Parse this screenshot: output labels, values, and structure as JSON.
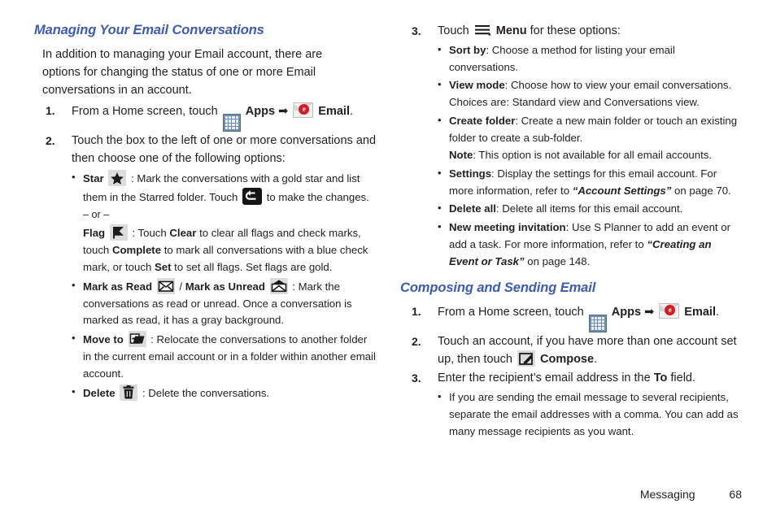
{
  "page": {
    "footer_section": "Messaging",
    "footer_page_number": "68",
    "heading_color": "#3b5bb5"
  },
  "left_column": {
    "heading": "Managing Your Email Conversations",
    "intro": "In addition to managing your Email account, there are options for changing the status of one or more Email conversations in an account.",
    "step1": {
      "number": "1.",
      "text_before_apps": "From a Home screen, touch",
      "apps_label": "Apps",
      "arrow": "➡",
      "email_label": "Email",
      "period": "."
    },
    "step2": {
      "number": "2.",
      "text": "Touch the box to the left of one or more conversations and then choose one of the following options:",
      "bullets": {
        "star": {
          "label": "Star",
          "text_a": ": Mark the conversations with a gold star and list them in the Starred folder. Touch",
          "text_b": "to make the changes.",
          "or_divider": "– or –"
        },
        "flag": {
          "label": "Flag",
          "seg1": ": Touch",
          "bold1": "Clear",
          "seg2": "to clear all flags and check marks, touch",
          "bold2": "Complete",
          "seg3": "to mark all conversations with a blue check mark, or touch",
          "bold3": "Set",
          "seg4": "to set all flags. Set flags are gold."
        },
        "mark_read": {
          "label_read": "Mark as Read",
          "separator": "/",
          "label_unread": "Mark as Unread",
          "text": ": Mark the conversations as read or unread. Once a conversation is marked as read, it has a gray background."
        },
        "move_to": {
          "label": "Move to",
          "text": ": Relocate the conversations to another folder in the current email account or in a folder within another email account."
        },
        "delete": {
          "label": "Delete",
          "text": ": Delete the conversations."
        }
      }
    }
  },
  "right_column": {
    "step3": {
      "number": "3.",
      "text_before_menu": "Touch",
      "menu_label": "Menu",
      "text_after_menu": "for these options:",
      "bullets": {
        "sort_by": {
          "label": "Sort by",
          "text": ": Choose a method for listing your email conversations."
        },
        "view_mode": {
          "label": "View mode",
          "text": ": Choose how to view your email conversations. Choices are: Standard view and Conversations view."
        },
        "create_folder": {
          "label": "Create folder",
          "text": ": Create a new main folder or touch an existing folder to create a sub-folder.",
          "note_label": "Note",
          "note_text": ": This option is not available for all email accounts."
        },
        "settings": {
          "label": "Settings",
          "text_a": ": Display the settings for this email account. For more information, refer to",
          "reference": "“Account Settings”",
          "text_b": "on page 70."
        },
        "delete_all": {
          "label": "Delete all",
          "text": ": Delete all items for this email account."
        },
        "new_meeting": {
          "label": "New meeting invitation",
          "text_a": ": Use S Planner to add an event or add a task. For more information, refer to",
          "reference": "“Creating an Event or Task”",
          "text_b": "on page 148."
        }
      }
    },
    "heading2": "Composing and Sending Email",
    "step1": {
      "number": "1.",
      "text_before_apps": "From a Home screen, touch",
      "apps_label": "Apps",
      "arrow": "➡",
      "email_label": "Email",
      "period": "."
    },
    "step2": {
      "number": "2.",
      "text_a": "Touch an account, if you have more than one account set up, then touch",
      "compose_label": "Compose",
      "period": "."
    },
    "step3b": {
      "number": "3.",
      "text_a": "Enter the recipient’s email address in the",
      "to_label": "To",
      "text_b": "field.",
      "bullet": "If you are sending the email message to several recipients, separate the email addresses with a comma. You can add as many message recipients as you want."
    }
  },
  "icons": {
    "apps": "apps-grid-icon",
    "email": "email-envelope-icon",
    "star": "star-icon",
    "back": "back-arrow-icon",
    "flag": "flag-icon",
    "mark_read": "envelope-closed-icon",
    "mark_unread": "envelope-open-icon",
    "move_to": "move-to-folder-icon",
    "delete": "trash-icon",
    "menu": "hamburger-menu-icon",
    "compose": "compose-pencil-icon"
  }
}
